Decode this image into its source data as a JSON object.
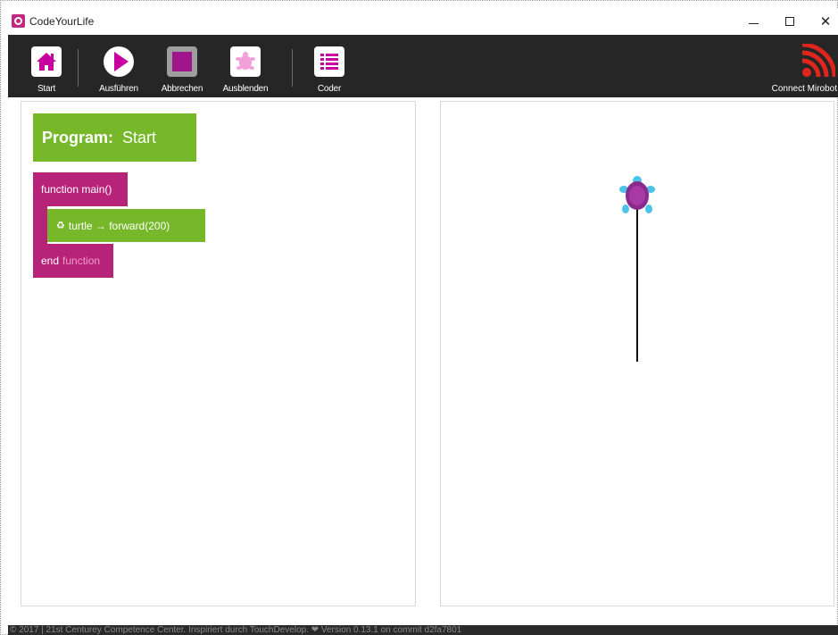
{
  "window": {
    "title": "CodeYourLife",
    "minimize_glyph": "",
    "maximize_glyph": "",
    "close_glyph": "✕"
  },
  "toolbar": {
    "buttons": [
      {
        "label": "Start",
        "icon": "home-icon"
      },
      {
        "label": "Ausführen",
        "icon": "play-icon"
      },
      {
        "label": "Abbrechen",
        "icon": "stop-icon"
      },
      {
        "label": "Ausblenden",
        "icon": "turtle-icon"
      },
      {
        "label": "Coder",
        "icon": "list-icon"
      }
    ],
    "connect_label": "Connect Mirobot",
    "connect_icon": "wifi-icon",
    "connect_color": "#e0261c"
  },
  "program": {
    "keyword": "Program:",
    "name": "Start",
    "function_header": "function main()",
    "statement": "turtle → forward(200)",
    "statement_icon": "recycle-icon",
    "end_keyword": "end",
    "end_function": "function"
  },
  "colors": {
    "program_green": "#76b82a",
    "function_magenta": "#b8237a",
    "accent_magenta": "#c800a0",
    "toolbar_bg": "#262626"
  },
  "footer": {
    "text": "© 2017 | 21st Centurey Competence Center. Inspiriert durch TouchDevelop. ❤ Version 0.13.1 on commit d2fa7801"
  }
}
